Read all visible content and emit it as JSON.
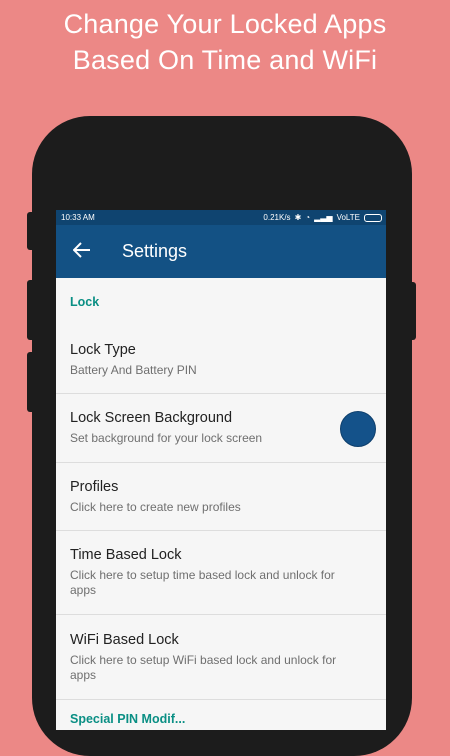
{
  "promo": {
    "line1": "Change Your Locked Apps",
    "line2": "Based On Time and WiFi"
  },
  "status_bar": {
    "time": "10:33 AM",
    "speed": "0.21K/s",
    "network": "VoLTE"
  },
  "app_bar": {
    "title": "Settings",
    "back_icon": "arrow-left-icon"
  },
  "settings": {
    "category_lock": "Lock",
    "items": [
      {
        "title": "Lock Type",
        "subtitle": "Battery And Battery PIN"
      },
      {
        "title": "Lock Screen Background",
        "subtitle": "Set background for your lock screen",
        "swatch_color": "#14528a"
      },
      {
        "title": "Profiles",
        "subtitle": "Click here to create new profiles"
      },
      {
        "title": "Time Based Lock",
        "subtitle": "Click here to setup time based lock and unlock for apps"
      },
      {
        "title": "WiFi Based Lock",
        "subtitle": "Click here to setup WiFi based lock and unlock for apps"
      }
    ],
    "next_category": "Special PIN Modif..."
  },
  "colors": {
    "background": "#ec8886",
    "app_bar": "#135184",
    "status_bar": "#0f4470",
    "accent": "#0a8f84"
  }
}
